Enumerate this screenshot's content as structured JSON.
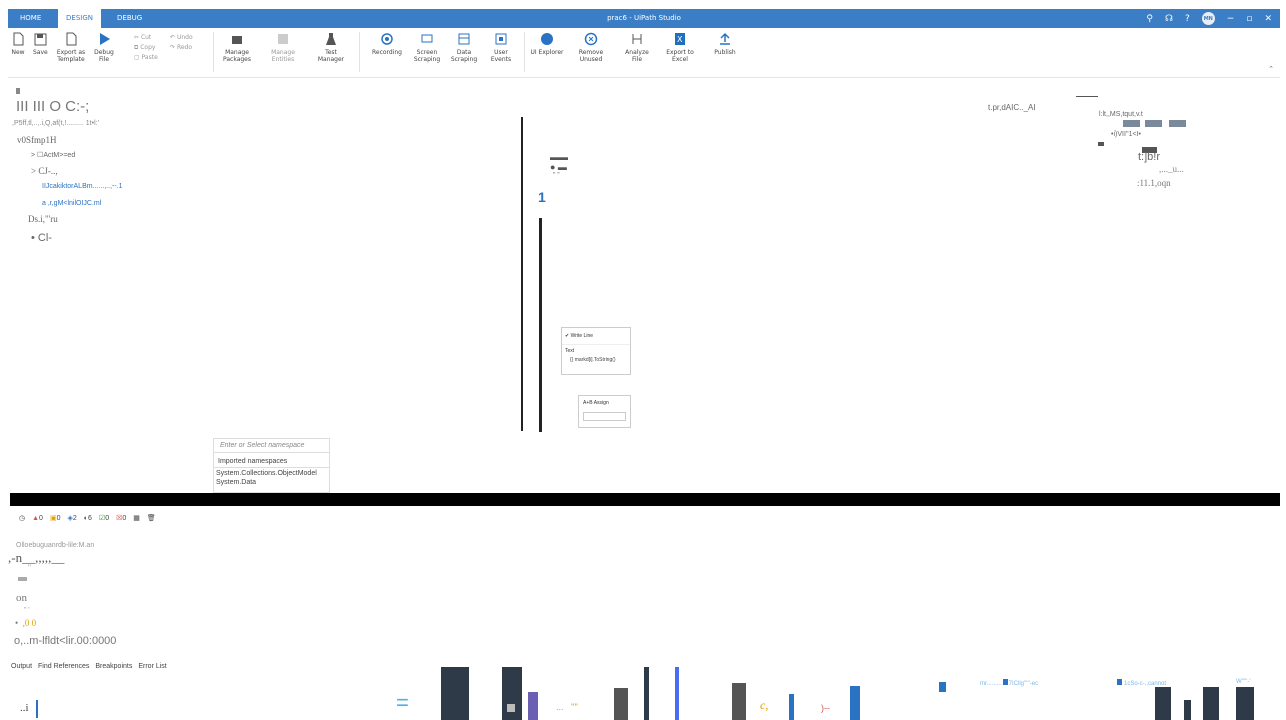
{
  "titlebar": {
    "tabs": [
      "HOME",
      "DESIGN",
      "DEBUG"
    ],
    "title": "prac6 - UiPath Studio",
    "avatar": "MN"
  },
  "ribbon": {
    "new": "New",
    "save": "Save",
    "export_template": "Export as Template",
    "debug_file": "Debug File",
    "cut": "Cut",
    "copy": "Copy",
    "paste": "Paste",
    "undo": "Undo",
    "redo": "Redo",
    "manage_packages": "Manage Packages",
    "manage_entities": "Manage Entities",
    "test_manager": "Test Manager",
    "recording": "Recording",
    "screen_scraping": "Screen Scraping",
    "data_scraping": "Data Scraping",
    "user_events": "User Events",
    "ui_explorer": "UI Explorer",
    "remove_unused": "Remove Unused",
    "analyze_file": "Analyze File",
    "export_excel": "Export to Excel",
    "publish": "Publish"
  },
  "left": {
    "l1": "III III O C:-;",
    "l2": ",P5ff,tl,..,.i,Q,af(t,!......... 1t•l:'",
    "l3": "v0Sfmp1H",
    "l4": "ActM>=ed",
    "l5": "CJ-..,",
    "l6": "IIJcakiktorALBm......,..,--.1",
    "l7": "a ,r,gM<lnilOIJC.ml",
    "l8": "Ds.i,\"'ru",
    "l9": "• Cl-"
  },
  "right": {
    "r1": "t.pr,dAIC.._AI",
    "r2": "l:lt,,MS,tqut,v.t",
    "r3": "•i)VII''1<I•",
    "r4": "t:]b!r",
    "r5": ",..._u...",
    "r6": ":11.1,oqn"
  },
  "canvas": {
    "one": "1",
    "writeline": "Write Line",
    "text_label": "Text",
    "text_value": "markd[i].ToString()",
    "assign": "Assign"
  },
  "namespace": {
    "placeholder": "Enter or Select namespace",
    "heading": "Imported namespaces",
    "item1": "System.Collections.ObjectModel",
    "item2": "System.Data"
  },
  "output": {
    "badges": [
      "0",
      "0",
      "2",
      "6",
      "0",
      "0"
    ],
    "o1": "Olloebuguanrdb-lile:M.an",
    "o2": ",-n__,,,,,__",
    "o3": "on",
    "o4": "o,..m-lfldt<lir.00:0000",
    "o5": ",0 0"
  },
  "bottom_tabs": [
    "Output",
    "Find References",
    "Breakpoints",
    "Error List"
  ],
  "taskbar": {
    "left": "..i",
    "t1": "mr.........",
    "t2": "7ICllg'''''-ec",
    "t3": "1cSo-c-.,cannot",
    "t4": "W'''''-'"
  },
  "colors": {
    "accent": "#3b7ec6",
    "dark": "#2e3a48",
    "warn": "#e0a000",
    "error": "#d9534f"
  }
}
